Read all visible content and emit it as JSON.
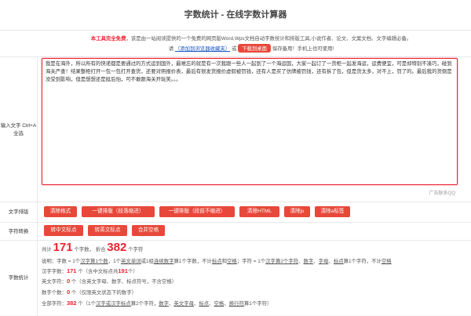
{
  "page": {
    "title": "字数统计 - 在线字数计算器"
  },
  "notice": {
    "highlight": "本工具完全免费",
    "text": "，该是由一站阅读提供的一个免费的网页版Word,Wps文档自动字数统计和排版工具,小说作者、论文、文案文档、文字编辑必备。"
  },
  "links": {
    "prefix": "请",
    "bookmark": "（添加到浏览器收藏夹）",
    "or": "或",
    "desktop_button": "下载到桌面",
    "suffix": "保存备用！手机上也可使用!"
  },
  "input": {
    "label": "输入文字 Ctrl+A 全选",
    "value": "我是在海外，所以所有的快递都是要通过的方式运到国外，最难忘的就是有一次我跟一些人一起到了一个海运国，大家一起订了一货柜一起发海运，运费便宜，可是却特别不凑巧，碰到海关严查！结果整柜打开一包一包打开查货，还要对照报价表，最后有很发货报价虚假被罚钱，还有人是买了仿牌被罚钱，还有拆了包，但是货太多，对不上，罚了的。最后我的货倒是没受到影响，但是想想还是挺后怕，可不敢跟海关开玩笑。。。"
  },
  "ad_text": "广告联系QQ",
  "typeset": {
    "label": "文字排版",
    "buttons": [
      "清除格式",
      "一键排版（段落缩进）",
      "一键排版（段前不缩进）",
      "清除HTML",
      "清除js",
      "清除a标签"
    ]
  },
  "convert": {
    "label": "字符转换",
    "buttons": [
      "转中文标点",
      "转英文标点",
      "合并空格"
    ]
  },
  "stats": {
    "label": "字数统计",
    "total_prefix": "共计",
    "total_words": "171",
    "total_unit": "个字数，",
    "fold_prefix": "折合",
    "total_chars": "382",
    "chars_unit": "个字符",
    "explain_prefix": "说明：字数 = 1个",
    "explain_1": "汉字算1个数",
    "explain_2": "，1个",
    "explain_3": "英文单词",
    "explain_4": "或1组",
    "explain_5": "连续数字",
    "explain_6": "算1个字数，不计",
    "explain_7": "标点",
    "explain_8": "和",
    "explain_9": "空格",
    "explain_10": "；字符 = 1个",
    "explain_11": "汉字算2个字符",
    "explain_12": "、",
    "explain_13": "数字",
    "explain_14": "、",
    "explain_15": "字母",
    "explain_16": "、",
    "explain_17": "标点",
    "explain_18": "算1个字符，不计",
    "explain_19": "空格",
    "hanzi_label": "汉字字数：",
    "hanzi_value": "171",
    "hanzi_note1": "个（含中文标点共",
    "hanzi_punct": "191",
    "hanzi_note2": "个）",
    "en_label": "英文字符：",
    "en_value": "0",
    "en_note": "个（含英文字母、数字、标点符号，不含空格）",
    "digit_label": "数字个数：",
    "digit_value": "0",
    "digit_note": "个（仅限英文状态下的数字）",
    "all_label": "全部字符：",
    "all_value": "382",
    "all_note_a": "个（1个",
    "all_note_b": "汉字或汉字标点",
    "all_note_c": "算2个字符，",
    "all_note_d": "数字",
    "all_note_e": "、",
    "all_note_f": "英文字母",
    "all_note_g": "、",
    "all_note_h": "标点",
    "all_note_i": "、",
    "all_note_j": "空格",
    "all_note_k": "、",
    "all_note_l": "换行符",
    "all_note_m": "算1个字符）"
  },
  "colors": {
    "accent": "#e8483a",
    "link": "#1a55c7"
  }
}
